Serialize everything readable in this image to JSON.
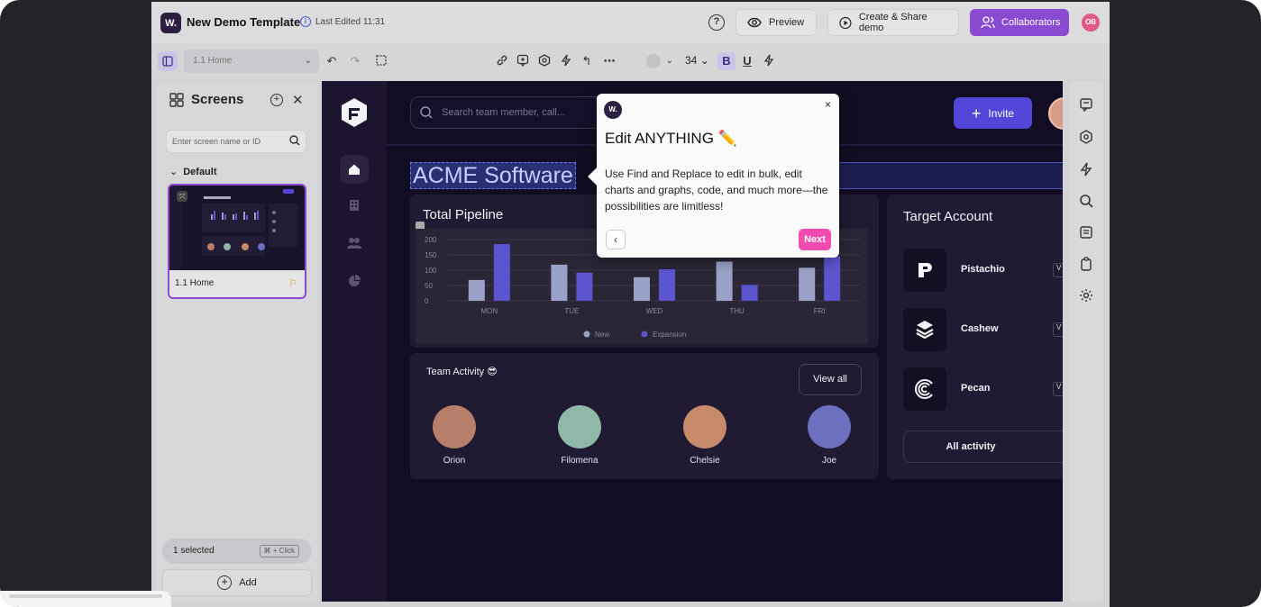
{
  "app": {
    "logo_text": "W.",
    "title": "New Demo Template",
    "last_edited": "Last Edited 11:31",
    "preview_label": "Preview",
    "create_share_label": "Create & Share demo",
    "collaborators_label": "Collaborators",
    "user_initials": "OB"
  },
  "toolbar": {
    "screen_select_value": "1.1  Home",
    "font_size": "34",
    "bold_label": "B",
    "underline_label": "U"
  },
  "screens_panel": {
    "title": "Screens",
    "search_placeholder": "Enter screen name or ID",
    "group_label": "Default",
    "screens": [
      {
        "name": "1.1 Home"
      }
    ],
    "selected_count": "1 selected",
    "shortcut_hint": "⌘ + Click",
    "add_label": "Add"
  },
  "dashboard": {
    "search_placeholder": "Search team member, call...",
    "invite_label": "Invite",
    "page_title": "ACME Software",
    "pipeline": {
      "title": "Total Pipeline"
    },
    "team": {
      "title": "Team Activity 😎",
      "view_all_label": "View all",
      "members": [
        {
          "name": "Orion",
          "color": "#b77f6b"
        },
        {
          "name": "Filomena",
          "color": "#8fb8a8"
        },
        {
          "name": "Chelsie",
          "color": "#c78b6c"
        },
        {
          "name": "Joe",
          "color": "#6d6fbf"
        }
      ]
    },
    "target": {
      "title": "Target Account",
      "accounts": [
        {
          "name": "Pistachio",
          "badge": "V"
        },
        {
          "name": "Cashew",
          "badge": "V"
        },
        {
          "name": "Pecan",
          "badge": "V"
        }
      ],
      "all_activity_label": "All activity"
    }
  },
  "popup": {
    "logo_text": "W.",
    "title": "Edit ANYTHING ✏️",
    "body": "Use Find and Replace to edit in bulk, edit charts and graphs, code, and much more—the possibilities are limitless!",
    "next_label": "Next",
    "close_label": "×"
  },
  "chart_data": {
    "type": "bar",
    "categories": [
      "MON",
      "TUE",
      "WED",
      "THU",
      "FRI"
    ],
    "series": [
      {
        "name": "New",
        "values": [
          68,
          118,
          77,
          128,
          108
        ],
        "color": "#9aa3c7"
      },
      {
        "name": "Expansion",
        "values": [
          185,
          92,
          103,
          52,
          145
        ],
        "color": "#5d55cf"
      }
    ],
    "ylim": [
      0,
      200
    ],
    "yticks": [
      "0",
      "50",
      "100",
      "150",
      "200"
    ],
    "grid": true,
    "legend": "bottom-center"
  }
}
